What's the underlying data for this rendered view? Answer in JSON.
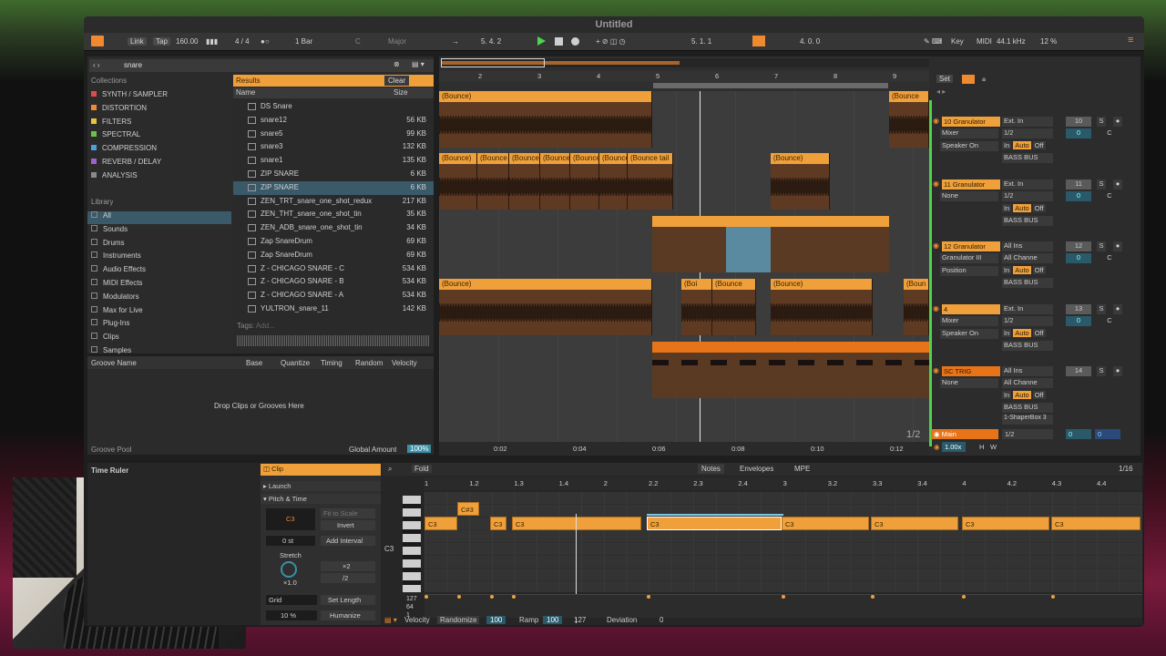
{
  "window": {
    "title": "Untitled"
  },
  "transport": {
    "link": "Link",
    "tap": "Tap",
    "tempo": "160.00",
    "meter": "4 / 4",
    "quantize": "1 Bar",
    "key": "C",
    "scale": "Major",
    "position": "5.  4.  2",
    "loop_start": "5.  1.  1",
    "loop_length": "4.  0.  0",
    "key_btn": "Key",
    "midi_btn": "MIDI",
    "sample_rate": "44.1 kHz",
    "cpu": "12 %"
  },
  "browser": {
    "search": "snare",
    "collections_header": "Collections",
    "collections": [
      {
        "label": "SYNTH / SAMPLER",
        "color": "#e04a4a"
      },
      {
        "label": "DISTORTION",
        "color": "#f08a30"
      },
      {
        "label": "FILTERS",
        "color": "#e8c440"
      },
      {
        "label": "SPECTRAL",
        "color": "#6ac24a"
      },
      {
        "label": "COMPRESSION",
        "color": "#4aa0e0"
      },
      {
        "label": "REVERB / DELAY",
        "color": "#a060d0"
      },
      {
        "label": "ANALYSIS",
        "color": "#8a8a8a"
      }
    ],
    "library_header": "Library",
    "library": [
      "All",
      "Sounds",
      "Drums",
      "Instruments",
      "Audio Effects",
      "MIDI Effects",
      "Modulators",
      "Max for Live",
      "Plug-Ins",
      "Clips",
      "Samples"
    ],
    "results_label": "Results",
    "clear_label": "Clear",
    "col_name": "Name",
    "col_size": "Size",
    "results": [
      {
        "name": "DS Snare",
        "size": ""
      },
      {
        "name": "snare12",
        "size": "56 KB"
      },
      {
        "name": "snare5",
        "size": "99 KB"
      },
      {
        "name": "snare3",
        "size": "132 KB"
      },
      {
        "name": "snare1",
        "size": "135 KB"
      },
      {
        "name": "ZIP SNARE",
        "size": "6 KB"
      },
      {
        "name": "ZIP SNARE",
        "size": "6 KB"
      },
      {
        "name": "ZEN_TRT_snare_one_shot_redux",
        "size": "217 KB"
      },
      {
        "name": "ZEN_THT_snare_one_shot_tin",
        "size": "35 KB"
      },
      {
        "name": "ZEN_ADB_snare_one_shot_tin",
        "size": "34 KB"
      },
      {
        "name": "Zap SnareDrum",
        "size": "69 KB"
      },
      {
        "name": "Zap SnareDrum",
        "size": "69 KB"
      },
      {
        "name": "Z - CHICAGO SNARE - C",
        "size": "534 KB"
      },
      {
        "name": "Z - CHICAGO SNARE - B",
        "size": "534 KB"
      },
      {
        "name": "Z - CHICAGO SNARE - A",
        "size": "534 KB"
      },
      {
        "name": "YULTRON_snare_11",
        "size": "142 KB"
      }
    ],
    "tags_label": "Tags:",
    "tags_add": "Add..."
  },
  "groove": {
    "cols": [
      "Groove Name",
      "Base",
      "Quantize",
      "Timing",
      "Random",
      "Velocity"
    ],
    "empty": "Drop Clips or Grooves Here",
    "pool_label": "Groove Pool",
    "global_label": "Global Amount",
    "global_value": "100%"
  },
  "arrangement": {
    "bars": [
      "2",
      "3",
      "4",
      "5",
      "6",
      "7",
      "8",
      "9"
    ],
    "times": [
      "0:02",
      "0:04",
      "0:06",
      "0:08",
      "0:10",
      "0:12"
    ],
    "set_label": "Set",
    "page_counter": "1/2",
    "clips": [
      "(Bounce)",
      "(Bounce",
      "(Bounce)",
      "(Bounce",
      "(Bounce",
      "(Bounce",
      "(Bounce",
      "(Bounce",
      "(Bounce tail",
      "(Bounce)",
      "(Bounce)",
      "(Boi",
      "(Boi",
      "(Bounce",
      "(Bounce)",
      "(Boun"
    ]
  },
  "tracks": [
    {
      "name": "10 Granulator",
      "in": "Ext. In",
      "ch": "1/2",
      "mon": [
        "In",
        "Auto",
        "Off"
      ],
      "out": "BASS BUS",
      "dev1": "Mixer",
      "dev2": "Speaker On",
      "num": "10",
      "vol": "0",
      "pan": "C"
    },
    {
      "name": "11 Granulator",
      "in": "Ext. In",
      "ch": "1/2",
      "mon": [
        "In",
        "Auto",
        "Off"
      ],
      "out": "BASS BUS",
      "dev1": "None",
      "dev2": "",
      "num": "11",
      "vol": "0",
      "pan": "C"
    },
    {
      "name": "12 Granulator",
      "in": "All Ins",
      "ch": "All Channe",
      "mon": [
        "In",
        "Auto",
        "Off"
      ],
      "out": "BASS BUS",
      "dev1": "Granulator III",
      "dev2": "Position",
      "num": "12",
      "vol": "0",
      "pan": "C"
    },
    {
      "name": "4",
      "in": "Ext. In",
      "ch": "1/2",
      "mon": [
        "In",
        "Auto",
        "Off"
      ],
      "out": "BASS BUS",
      "dev1": "Mixer",
      "dev2": "Speaker On",
      "num": "13",
      "vol": "0",
      "pan": "C"
    },
    {
      "name": "SC TRIG",
      "in": "All Ins",
      "ch": "All Channe",
      "mon": [
        "In",
        "Auto",
        "Off"
      ],
      "out": "BASS BUS",
      "dev1": "None",
      "dev2": "",
      "num": "14",
      "vol": "",
      "pan": "",
      "extra": "1-ShaperBox 3"
    }
  ],
  "main": {
    "name": "Main",
    "out": "1/2",
    "vol": "0",
    "pan": "0",
    "speed": "1.00x",
    "h": "H",
    "w": "W"
  },
  "clip_view": {
    "time_ruler": "Time Ruler",
    "clip_tab": "Clip",
    "fold": "Fold",
    "notes_tab": "Notes",
    "env_tab": "Envelopes",
    "mpe_tab": "MPE",
    "grid_label": "1/16",
    "launch": "Launch",
    "pitch_time": "Pitch & Time",
    "root_note": "C3",
    "fit_scale": "Fit to Scale",
    "invert": "Invert",
    "transpose": "0 st",
    "add_interval": "Add Interval",
    "stretch": "Stretch",
    "stretch_val": "×1.0",
    "x2": "×2",
    "div2": "/2",
    "grid": "Grid",
    "set_length": "Set Length",
    "humanize_val": "10 %",
    "humanize": "Humanize",
    "ruler": [
      "1",
      "1.2",
      "1.3",
      "1.4",
      "2",
      "2.2",
      "2.3",
      "2.4",
      "3",
      "3.2",
      "3.3",
      "3.4",
      "4",
      "4.2",
      "4.3",
      "4.4"
    ],
    "key_label": "C3",
    "notes": [
      "C3",
      "C#3",
      "C3",
      "C3",
      "C3",
      "C3",
      "C3",
      "C3",
      "C3"
    ],
    "vel_labels": [
      "127",
      "64",
      "1"
    ],
    "velocity": "Velocity",
    "randomize": "Randomize",
    "rand_val": "100",
    "ramp": "Ramp",
    "ramp_a": "100",
    "ramp_b": "127",
    "deviation": "Deviation",
    "dev_val": "0"
  }
}
